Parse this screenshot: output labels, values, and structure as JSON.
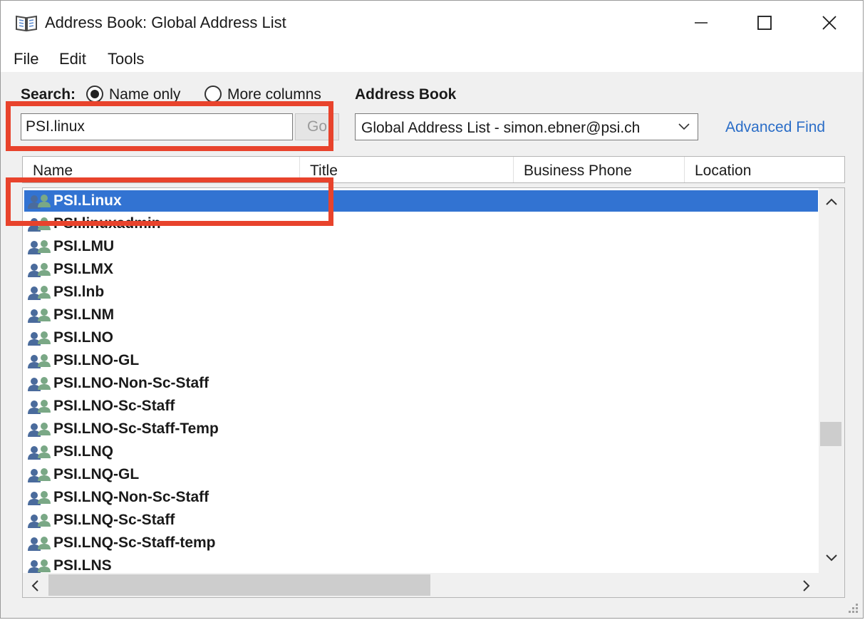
{
  "window": {
    "title": "Address Book: Global Address List",
    "app_icon": "address-book-icon"
  },
  "menu": {
    "file": "File",
    "edit": "Edit",
    "tools": "Tools"
  },
  "search": {
    "label": "Search:",
    "option_name_only": "Name only",
    "option_more_columns": "More columns",
    "selected_option": "Name only",
    "input_value": "PSI.linux",
    "go_label": "Go"
  },
  "address_book": {
    "label": "Address Book",
    "selected": "Global Address List - simon.ebner@psi.ch",
    "advanced_find": "Advanced Find"
  },
  "columns": {
    "name": "Name",
    "title": "Title",
    "business_phone": "Business Phone",
    "location": "Location"
  },
  "list": {
    "selected_index": 0,
    "items": [
      "PSI.Linux",
      "PSI.linuxadmin",
      "PSI.LMU",
      "PSI.LMX",
      "PSI.lnb",
      "PSI.LNM",
      "PSI.LNO",
      "PSI.LNO-GL",
      "PSI.LNO-Non-Sc-Staff",
      "PSI.LNO-Sc-Staff",
      "PSI.LNO-Sc-Staff-Temp",
      "PSI.LNQ",
      "PSI.LNQ-GL",
      "PSI.LNQ-Non-Sc-Staff",
      "PSI.LNQ-Sc-Staff",
      "PSI.LNQ-Sc-Staff-temp",
      "PSI.LNS"
    ]
  },
  "colors": {
    "selection": "#3273d2",
    "annotation": "#e8432c",
    "link": "#2a6dc7",
    "group_icon_blue": "#4a6b9c",
    "group_icon_green": "#7aa886"
  }
}
